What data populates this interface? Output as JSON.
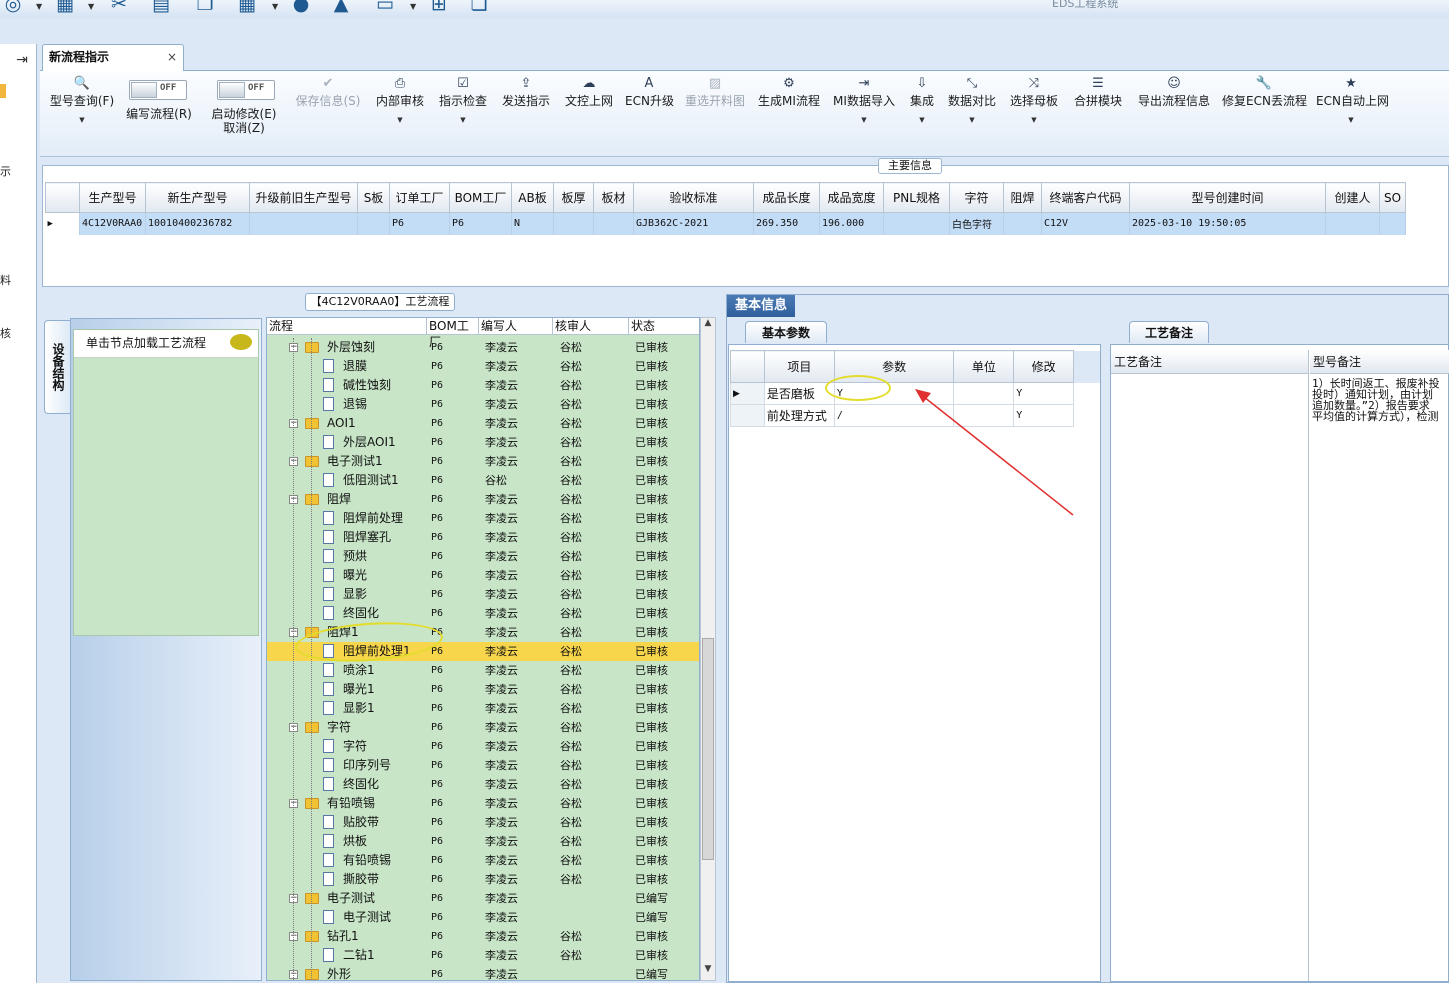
{
  "app_title": "EDS工程系统",
  "left_strip": [
    "",
    "示",
    "",
    "料",
    "核"
  ],
  "tab": {
    "label": "新流程指示",
    "close": "×"
  },
  "toolbar": {
    "query": "型号查询(F)",
    "write_flow": "编写流程(R)",
    "enable_modify": "启动修改(E)",
    "cancel": "取消(Z)",
    "toggle_off": "OFF",
    "save_info": "保存信息(S)",
    "internal_review": "内部审核",
    "check_indication": "指示检查",
    "send_indication": "发送指示",
    "doc_upload": "文控上网",
    "ecn_upgrade": "ECN升级",
    "reselect_chart": "重选开料图",
    "gen_mi_flow": "生成MI流程",
    "mi_import": "MI数据导入",
    "integrate": "集成",
    "data_compare": "数据对比",
    "select_mother": "选择母板",
    "merge_module": "合拼模块",
    "export_flow": "导出流程信息",
    "repair_ecn": "修复ECN丢流程",
    "ecn_auto": "ECN自动上网"
  },
  "main_info": {
    "title": "主要信息",
    "columns": [
      "生产型号",
      "新生产型号",
      "升级前旧生产型号",
      "S板",
      "订单工厂",
      "BOM工厂",
      "AB板",
      "板厚",
      "板材",
      "验收标准",
      "成品长度",
      "成品宽度",
      "PNL规格",
      "字符",
      "阻焊",
      "终端客户代码",
      "型号创建时间",
      "创建人",
      "SO"
    ],
    "row": [
      "4C12V0RAA0",
      "10010400236782",
      "",
      "",
      "P6",
      "P6",
      "N",
      "",
      "",
      "GJB362C-2021",
      "269.350",
      "196.000",
      "",
      "白色字符",
      "",
      "C12V",
      "2025-03-10 19:50:05",
      "",
      ""
    ]
  },
  "process": {
    "title": "【4C12V0RAA0】工艺流程",
    "vtab": "设备结构",
    "load_label": "单击节点加载工艺流程",
    "headers": [
      "流程",
      "BOM工厂",
      "编写人",
      "核审人",
      "状态"
    ],
    "rows": [
      {
        "name": "外层蚀刻",
        "f": "P6",
        "w": "李凌云",
        "r": "谷松",
        "s": "已审核",
        "lvl": 0
      },
      {
        "name": "退膜",
        "f": "P6",
        "w": "李凌云",
        "r": "谷松",
        "s": "已审核",
        "lvl": 1
      },
      {
        "name": "碱性蚀刻",
        "f": "P6",
        "w": "李凌云",
        "r": "谷松",
        "s": "已审核",
        "lvl": 1
      },
      {
        "name": "退锡",
        "f": "P6",
        "w": "李凌云",
        "r": "谷松",
        "s": "已审核",
        "lvl": 1
      },
      {
        "name": "AOI1",
        "f": "P6",
        "w": "李凌云",
        "r": "谷松",
        "s": "已审核",
        "lvl": 0
      },
      {
        "name": "外层AOI1",
        "f": "P6",
        "w": "李凌云",
        "r": "谷松",
        "s": "已审核",
        "lvl": 1
      },
      {
        "name": "电子测试1",
        "f": "P6",
        "w": "李凌云",
        "r": "谷松",
        "s": "已审核",
        "lvl": 0
      },
      {
        "name": "低阻测试1",
        "f": "P6",
        "w": "谷松",
        "r": "谷松",
        "s": "已审核",
        "lvl": 1
      },
      {
        "name": "阻焊",
        "f": "P6",
        "w": "李凌云",
        "r": "谷松",
        "s": "已审核",
        "lvl": 0
      },
      {
        "name": "阻焊前处理",
        "f": "P6",
        "w": "李凌云",
        "r": "谷松",
        "s": "已审核",
        "lvl": 1
      },
      {
        "name": "阻焊塞孔",
        "f": "P6",
        "w": "李凌云",
        "r": "谷松",
        "s": "已审核",
        "lvl": 1
      },
      {
        "name": "预烘",
        "f": "P6",
        "w": "李凌云",
        "r": "谷松",
        "s": "已审核",
        "lvl": 1
      },
      {
        "name": "曝光",
        "f": "P6",
        "w": "李凌云",
        "r": "谷松",
        "s": "已审核",
        "lvl": 1
      },
      {
        "name": "显影",
        "f": "P6",
        "w": "李凌云",
        "r": "谷松",
        "s": "已审核",
        "lvl": 1
      },
      {
        "name": "终固化",
        "f": "P6",
        "w": "李凌云",
        "r": "谷松",
        "s": "已审核",
        "lvl": 1
      },
      {
        "name": "阻焊1",
        "f": "P6",
        "w": "李凌云",
        "r": "谷松",
        "s": "已审核",
        "lvl": 0
      },
      {
        "name": "阻焊前处理1",
        "f": "P6",
        "w": "李凌云",
        "r": "谷松",
        "s": "已审核",
        "lvl": 1,
        "sel": true
      },
      {
        "name": "喷涂1",
        "f": "P6",
        "w": "李凌云",
        "r": "谷松",
        "s": "已审核",
        "lvl": 1
      },
      {
        "name": "曝光1",
        "f": "P6",
        "w": "李凌云",
        "r": "谷松",
        "s": "已审核",
        "lvl": 1
      },
      {
        "name": "显影1",
        "f": "P6",
        "w": "李凌云",
        "r": "谷松",
        "s": "已审核",
        "lvl": 1
      },
      {
        "name": "字符",
        "f": "P6",
        "w": "李凌云",
        "r": "谷松",
        "s": "已审核",
        "lvl": 0
      },
      {
        "name": "字符",
        "f": "P6",
        "w": "李凌云",
        "r": "谷松",
        "s": "已审核",
        "lvl": 1
      },
      {
        "name": "印序列号",
        "f": "P6",
        "w": "李凌云",
        "r": "谷松",
        "s": "已审核",
        "lvl": 1
      },
      {
        "name": "终固化",
        "f": "P6",
        "w": "李凌云",
        "r": "谷松",
        "s": "已审核",
        "lvl": 1
      },
      {
        "name": "有铅喷锡",
        "f": "P6",
        "w": "李凌云",
        "r": "谷松",
        "s": "已审核",
        "lvl": 0
      },
      {
        "name": "贴胶带",
        "f": "P6",
        "w": "李凌云",
        "r": "谷松",
        "s": "已审核",
        "lvl": 1
      },
      {
        "name": "烘板",
        "f": "P6",
        "w": "李凌云",
        "r": "谷松",
        "s": "已审核",
        "lvl": 1
      },
      {
        "name": "有铅喷锡",
        "f": "P6",
        "w": "李凌云",
        "r": "谷松",
        "s": "已审核",
        "lvl": 1
      },
      {
        "name": "撕胶带",
        "f": "P6",
        "w": "李凌云",
        "r": "谷松",
        "s": "已审核",
        "lvl": 1
      },
      {
        "name": "电子测试",
        "f": "P6",
        "w": "李凌云",
        "r": "",
        "s": "已编写",
        "lvl": 0
      },
      {
        "name": "电子测试",
        "f": "P6",
        "w": "李凌云",
        "r": "",
        "s": "已编写",
        "lvl": 1
      },
      {
        "name": "钻孔1",
        "f": "P6",
        "w": "李凌云",
        "r": "谷松",
        "s": "已审核",
        "lvl": 0
      },
      {
        "name": "二钻1",
        "f": "P6",
        "w": "李凌云",
        "r": "谷松",
        "s": "已审核",
        "lvl": 1
      },
      {
        "name": "外形",
        "f": "P6",
        "w": "李凌云",
        "r": "",
        "s": "已编写",
        "lvl": 0
      }
    ]
  },
  "basic": {
    "tab": "基本信息",
    "sub_tab": "基本参数",
    "headers": [
      "项目",
      "参数",
      "单位",
      "修改"
    ],
    "rows": [
      [
        "是否磨板",
        "Y",
        "",
        "Y"
      ],
      [
        "前处理方式",
        "/",
        "",
        "Y"
      ]
    ]
  },
  "notes": {
    "tab": "工艺备注",
    "col1": "工艺备注",
    "col2": "型号备注",
    "text": "1）长时间返工、报废补投\n投时）通知计划，由计划\n追加数量。”2）报告要求\n平均值的计算方式），检测"
  }
}
